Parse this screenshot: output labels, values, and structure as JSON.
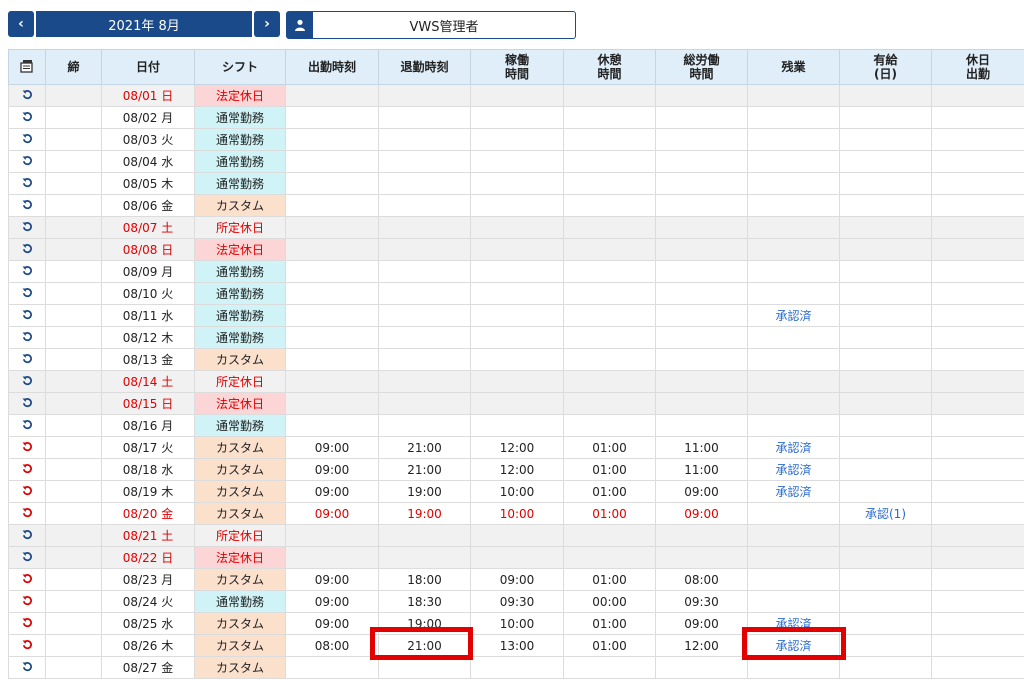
{
  "nav": {
    "prev_label": "‹",
    "next_label": "›",
    "month": "2021年 8月"
  },
  "user": {
    "name": "VWS管理者",
    "icon": "person-icon"
  },
  "headers": {
    "icon": "export-icon",
    "close": "締",
    "date": "日付",
    "shift": "シフト",
    "start": "出勤時刻",
    "end": "退勤時刻",
    "work1": "稼働",
    "work2": "時間",
    "break1": "休憩",
    "break2": "時間",
    "total1": "総労働",
    "total2": "時間",
    "ot": "残業",
    "paid1": "有給",
    "paid2": "(日)",
    "hol1": "休日",
    "hol2": "出勤"
  },
  "colors": {
    "accent": "#1a4a8a",
    "holiday_red": "#e00000",
    "highlight": "#e30000",
    "link": "#2a6bd1"
  },
  "rows": [
    {
      "date": "08/01 日",
      "shift": "法定休日",
      "shift_type": "hol",
      "red": true,
      "weekend": true,
      "icon": "blue",
      "start": "",
      "end": "",
      "work": "",
      "brk": "",
      "total": "",
      "ot": "",
      "paid": ""
    },
    {
      "date": "08/02 月",
      "shift": "通常勤務",
      "shift_type": "norm",
      "red": false,
      "weekend": false,
      "icon": "blue",
      "start": "",
      "end": "",
      "work": "",
      "brk": "",
      "total": "",
      "ot": "",
      "paid": ""
    },
    {
      "date": "08/03 火",
      "shift": "通常勤務",
      "shift_type": "norm",
      "red": false,
      "weekend": false,
      "icon": "blue",
      "start": "",
      "end": "",
      "work": "",
      "brk": "",
      "total": "",
      "ot": "",
      "paid": ""
    },
    {
      "date": "08/04 水",
      "shift": "通常勤務",
      "shift_type": "norm",
      "red": false,
      "weekend": false,
      "icon": "blue",
      "start": "",
      "end": "",
      "work": "",
      "brk": "",
      "total": "",
      "ot": "",
      "paid": ""
    },
    {
      "date": "08/05 木",
      "shift": "通常勤務",
      "shift_type": "norm",
      "red": false,
      "weekend": false,
      "icon": "blue",
      "start": "",
      "end": "",
      "work": "",
      "brk": "",
      "total": "",
      "ot": "",
      "paid": ""
    },
    {
      "date": "08/06 金",
      "shift": "カスタム",
      "shift_type": "cust",
      "red": false,
      "weekend": false,
      "icon": "blue",
      "start": "",
      "end": "",
      "work": "",
      "brk": "",
      "total": "",
      "ot": "",
      "paid": ""
    },
    {
      "date": "08/07 土",
      "shift": "所定休日",
      "shift_type": "sched",
      "red": true,
      "weekend": true,
      "icon": "blue",
      "start": "",
      "end": "",
      "work": "",
      "brk": "",
      "total": "",
      "ot": "",
      "paid": ""
    },
    {
      "date": "08/08 日",
      "shift": "法定休日",
      "shift_type": "hol",
      "red": true,
      "weekend": true,
      "icon": "blue",
      "start": "",
      "end": "",
      "work": "",
      "brk": "",
      "total": "",
      "ot": "",
      "paid": ""
    },
    {
      "date": "08/09 月",
      "shift": "通常勤務",
      "shift_type": "norm",
      "red": false,
      "weekend": false,
      "icon": "blue",
      "start": "",
      "end": "",
      "work": "",
      "brk": "",
      "total": "",
      "ot": "",
      "paid": ""
    },
    {
      "date": "08/10 火",
      "shift": "通常勤務",
      "shift_type": "norm",
      "red": false,
      "weekend": false,
      "icon": "blue",
      "start": "",
      "end": "",
      "work": "",
      "brk": "",
      "total": "",
      "ot": "",
      "paid": ""
    },
    {
      "date": "08/11 水",
      "shift": "通常勤務",
      "shift_type": "norm",
      "red": false,
      "weekend": false,
      "icon": "blue",
      "start": "",
      "end": "",
      "work": "",
      "brk": "",
      "total": "",
      "ot": "承認済",
      "paid": ""
    },
    {
      "date": "08/12 木",
      "shift": "通常勤務",
      "shift_type": "norm",
      "red": false,
      "weekend": false,
      "icon": "blue",
      "start": "",
      "end": "",
      "work": "",
      "brk": "",
      "total": "",
      "ot": "",
      "paid": ""
    },
    {
      "date": "08/13 金",
      "shift": "カスタム",
      "shift_type": "cust",
      "red": false,
      "weekend": false,
      "icon": "blue",
      "start": "",
      "end": "",
      "work": "",
      "brk": "",
      "total": "",
      "ot": "",
      "paid": ""
    },
    {
      "date": "08/14 土",
      "shift": "所定休日",
      "shift_type": "sched",
      "red": true,
      "weekend": true,
      "icon": "blue",
      "start": "",
      "end": "",
      "work": "",
      "brk": "",
      "total": "",
      "ot": "",
      "paid": ""
    },
    {
      "date": "08/15 日",
      "shift": "法定休日",
      "shift_type": "hol",
      "red": true,
      "weekend": true,
      "icon": "blue",
      "start": "",
      "end": "",
      "work": "",
      "brk": "",
      "total": "",
      "ot": "",
      "paid": ""
    },
    {
      "date": "08/16 月",
      "shift": "通常勤務",
      "shift_type": "norm",
      "red": false,
      "weekend": false,
      "icon": "blue",
      "start": "",
      "end": "",
      "work": "",
      "brk": "",
      "total": "",
      "ot": "",
      "paid": ""
    },
    {
      "date": "08/17 火",
      "shift": "カスタム",
      "shift_type": "cust",
      "red": false,
      "weekend": false,
      "icon": "red",
      "start": "09:00",
      "end": "21:00",
      "work": "12:00",
      "brk": "01:00",
      "total": "11:00",
      "ot": "承認済",
      "paid": ""
    },
    {
      "date": "08/18 水",
      "shift": "カスタム",
      "shift_type": "cust",
      "red": false,
      "weekend": false,
      "icon": "red",
      "start": "09:00",
      "end": "21:00",
      "work": "12:00",
      "brk": "01:00",
      "total": "11:00",
      "ot": "承認済",
      "paid": ""
    },
    {
      "date": "08/19 木",
      "shift": "カスタム",
      "shift_type": "cust",
      "red": false,
      "weekend": false,
      "icon": "red",
      "start": "09:00",
      "end": "19:00",
      "work": "10:00",
      "brk": "01:00",
      "total": "09:00",
      "ot": "承認済",
      "paid": ""
    },
    {
      "date": "08/20 金",
      "shift": "カスタム",
      "shift_type": "cust",
      "red": true,
      "weekend": false,
      "icon": "red",
      "start": "09:00",
      "end": "19:00",
      "work": "10:00",
      "brk": "01:00",
      "total": "09:00",
      "ot": "",
      "paid": "承認(1)"
    },
    {
      "date": "08/21 土",
      "shift": "所定休日",
      "shift_type": "sched",
      "red": true,
      "weekend": true,
      "icon": "blue",
      "start": "",
      "end": "",
      "work": "",
      "brk": "",
      "total": "",
      "ot": "",
      "paid": ""
    },
    {
      "date": "08/22 日",
      "shift": "法定休日",
      "shift_type": "hol",
      "red": true,
      "weekend": true,
      "icon": "blue",
      "start": "",
      "end": "",
      "work": "",
      "brk": "",
      "total": "",
      "ot": "",
      "paid": ""
    },
    {
      "date": "08/23 月",
      "shift": "カスタム",
      "shift_type": "cust",
      "red": false,
      "weekend": false,
      "icon": "red",
      "start": "09:00",
      "end": "18:00",
      "work": "09:00",
      "brk": "01:00",
      "total": "08:00",
      "ot": "",
      "paid": ""
    },
    {
      "date": "08/24 火",
      "shift": "通常勤務",
      "shift_type": "norm",
      "red": false,
      "weekend": false,
      "icon": "red",
      "start": "09:00",
      "end": "18:30",
      "work": "09:30",
      "brk": "00:00",
      "total": "09:30",
      "ot": "",
      "paid": ""
    },
    {
      "date": "08/25 水",
      "shift": "カスタム",
      "shift_type": "cust",
      "red": false,
      "weekend": false,
      "icon": "red",
      "start": "09:00",
      "end": "19:00",
      "work": "10:00",
      "brk": "01:00",
      "total": "09:00",
      "ot": "承認済",
      "paid": ""
    },
    {
      "date": "08/26 木",
      "shift": "カスタム",
      "shift_type": "cust",
      "red": false,
      "weekend": false,
      "icon": "red",
      "start": "08:00",
      "end": "21:00",
      "work": "13:00",
      "brk": "01:00",
      "total": "12:00",
      "ot": "承認済",
      "paid": ""
    },
    {
      "date": "08/27 金",
      "shift": "カスタム",
      "shift_type": "cust",
      "red": false,
      "weekend": false,
      "icon": "blue",
      "start": "",
      "end": "",
      "work": "",
      "brk": "",
      "total": "",
      "ot": "",
      "paid": ""
    }
  ]
}
